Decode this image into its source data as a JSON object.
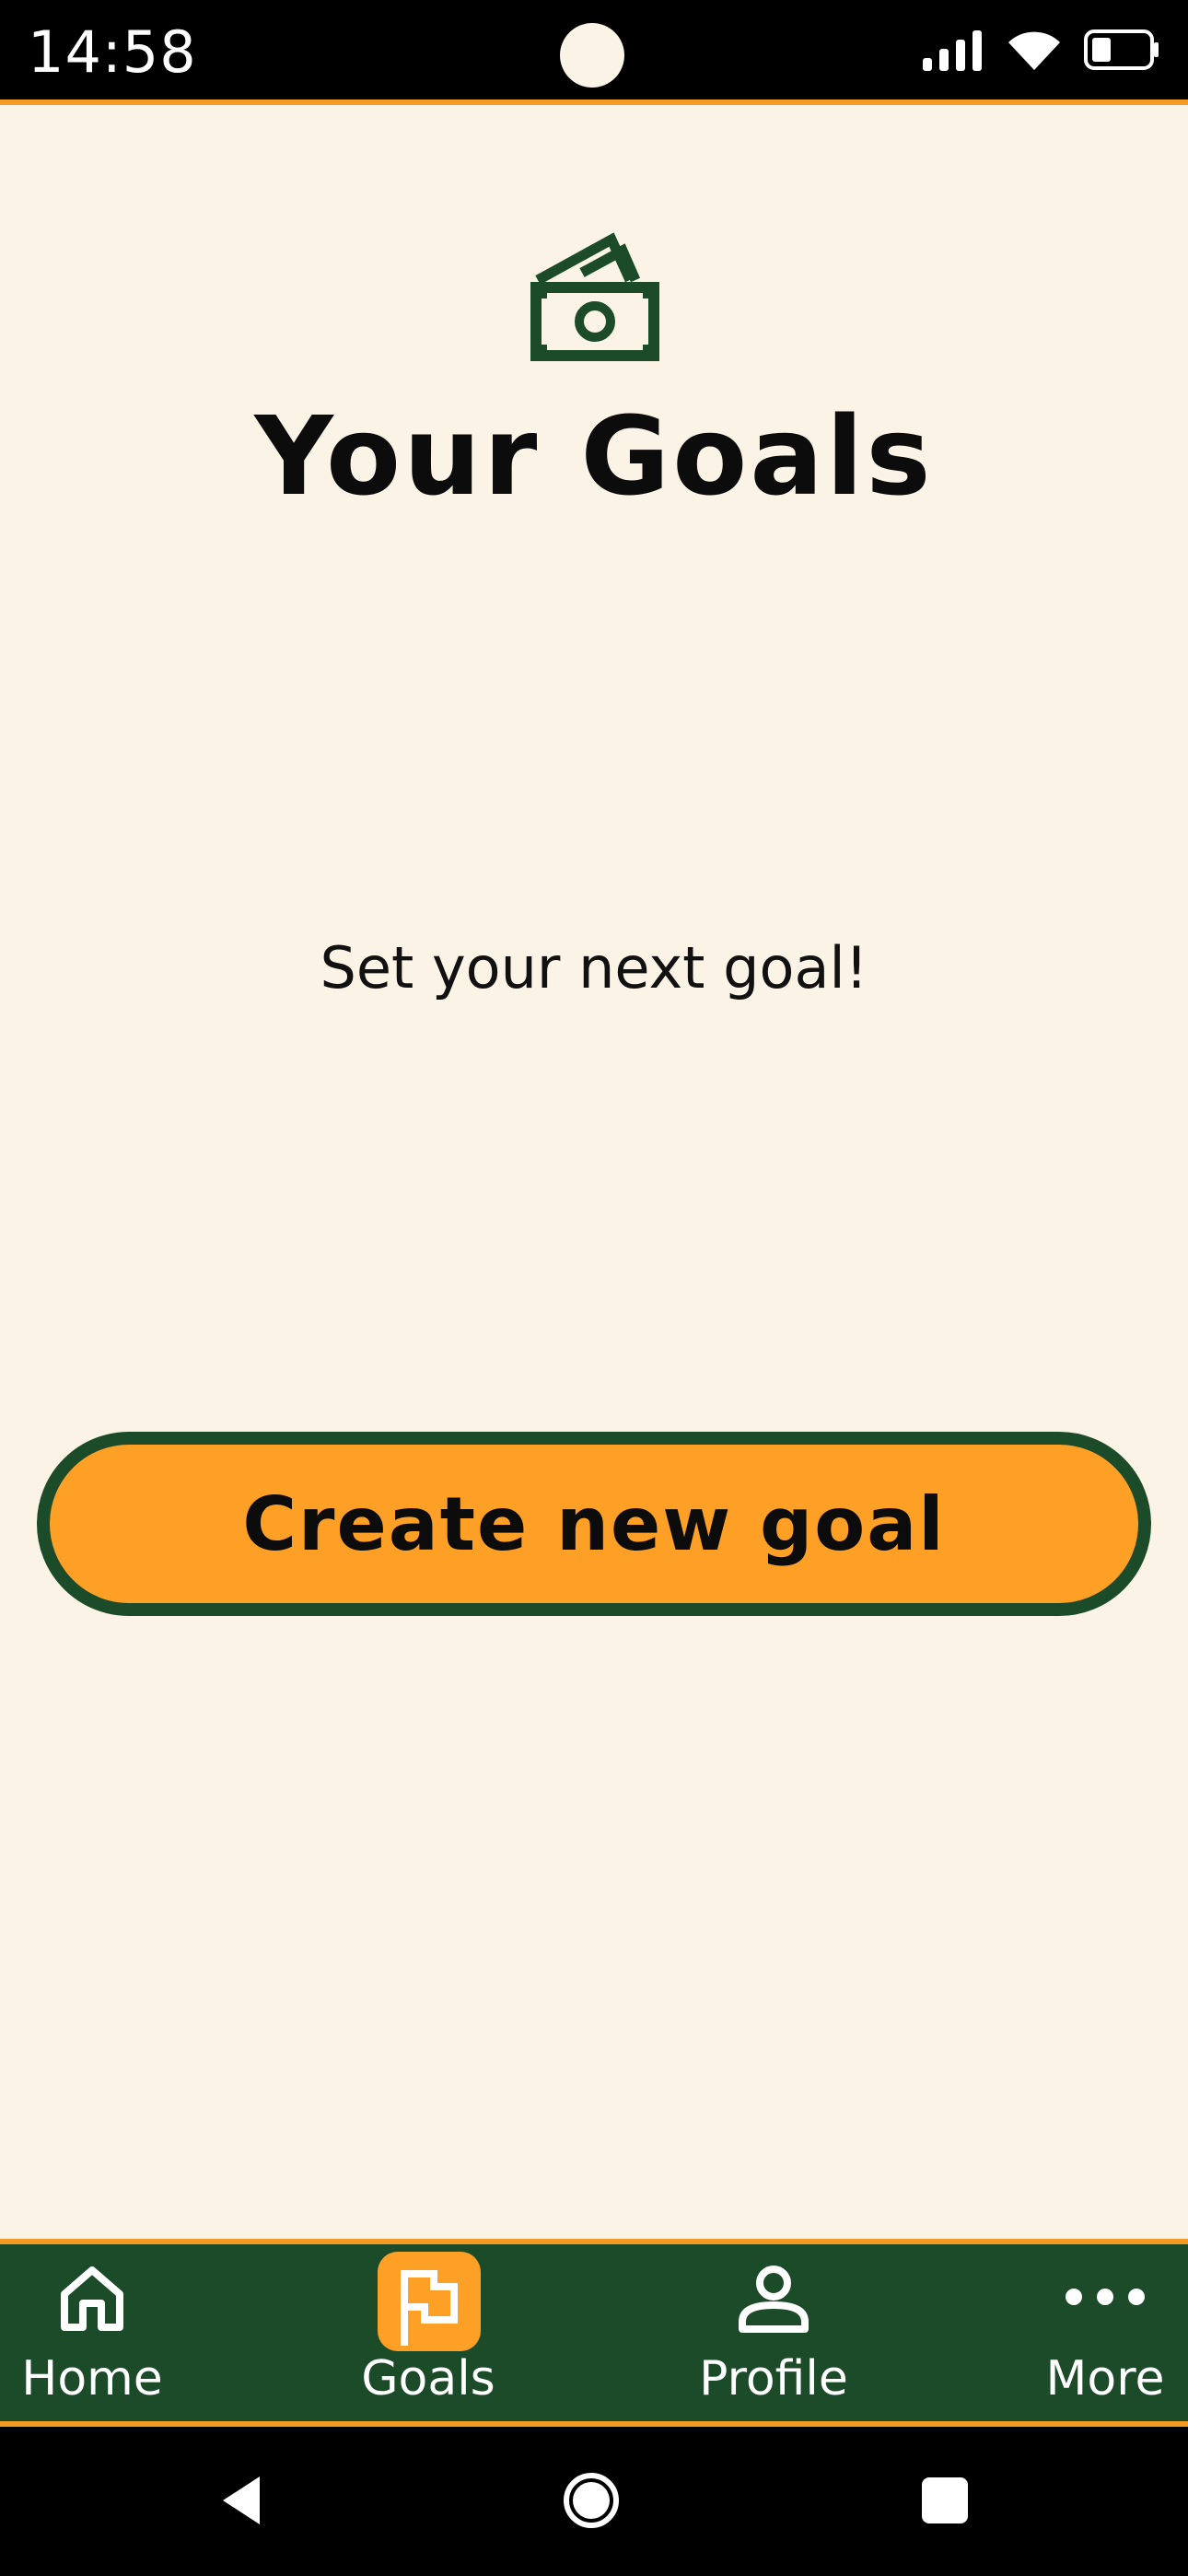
{
  "status_bar": {
    "time": "14:58"
  },
  "page": {
    "title": "Your Goals",
    "subtitle": "Set your next goal!",
    "create_button_label": "Create new goal",
    "header_icon": "money-icon"
  },
  "bottom_nav": {
    "items": [
      {
        "label": "Home",
        "icon": "home-icon"
      },
      {
        "label": "Goals",
        "icon": "flag-icon",
        "active": true
      },
      {
        "label": "Profile",
        "icon": "profile-icon"
      },
      {
        "label": "More",
        "icon": "more-icon"
      }
    ]
  },
  "colors": {
    "background": "#faf3e6",
    "accent_orange": "#fea026",
    "dark_green": "#1c4b2a",
    "divider_orange": "#f59a23"
  }
}
